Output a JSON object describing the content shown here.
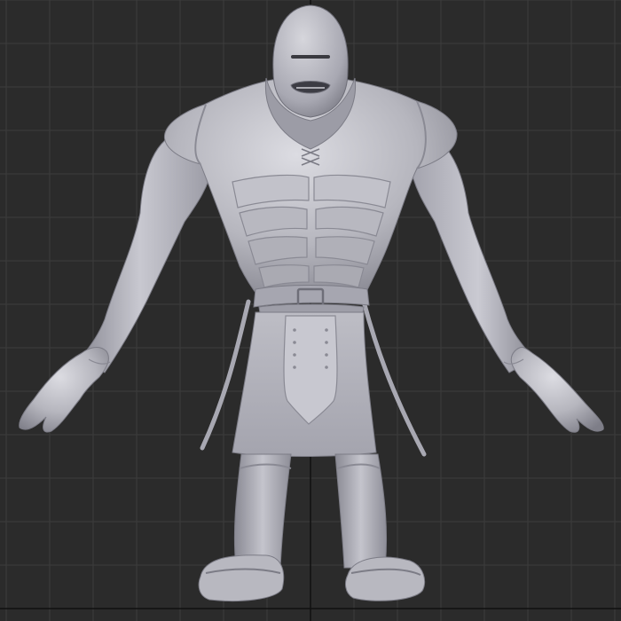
{
  "viewport": {
    "background_color": "#2b2b2b",
    "grid_color": "#3c3c3c",
    "axis_color": "#111111",
    "shading": "solid",
    "object_color": "#b9b9c0"
  },
  "model": {
    "subject": "armored-knight-sculpt",
    "pose": "a-pose"
  }
}
